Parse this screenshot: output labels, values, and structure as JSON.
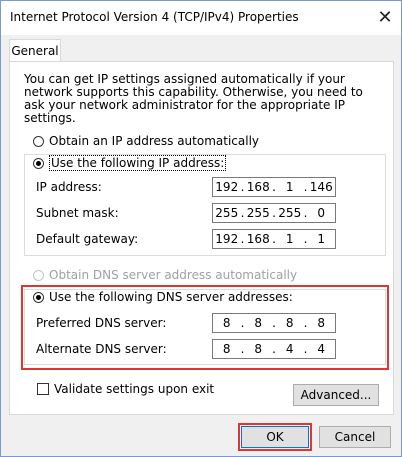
{
  "window": {
    "title": "Internet Protocol Version 4 (TCP/IPv4) Properties",
    "close_symbol": "✕"
  },
  "tabs": [
    {
      "label": "General",
      "selected": true
    }
  ],
  "description": "You can get IP settings assigned automatically if your network supports this capability. Otherwise, you need to ask your network administrator for the appropriate IP settings.",
  "ip_mode": {
    "auto_label": "Obtain an IP address automatically",
    "auto_selected": false,
    "manual_label": "Use the following IP address:",
    "manual_selected": true
  },
  "ip_fields": {
    "ip_label": "IP address:",
    "ip_value": [
      "192",
      "168",
      "1",
      "146"
    ],
    "subnet_label": "Subnet mask:",
    "subnet_value": [
      "255",
      "255",
      "255",
      "0"
    ],
    "gateway_label": "Default gateway:",
    "gateway_value": [
      "192",
      "168",
      "1",
      "1"
    ]
  },
  "dns_mode": {
    "auto_label": "Obtain DNS server address automatically",
    "auto_disabled": true,
    "manual_label": "Use the following DNS server addresses:",
    "manual_selected": true
  },
  "dns_fields": {
    "preferred_label": "Preferred DNS server:",
    "preferred_value": [
      "8",
      "8",
      "8",
      "8"
    ],
    "alternate_label": "Alternate DNS server:",
    "alternate_value": [
      "8",
      "8",
      "4",
      "4"
    ]
  },
  "validate": {
    "label": "Validate settings upon exit",
    "checked": false
  },
  "buttons": {
    "advanced": "Advanced...",
    "ok": "OK",
    "cancel": "Cancel"
  },
  "colors": {
    "highlight": "#e03535",
    "focus_border": "#0078d7"
  }
}
